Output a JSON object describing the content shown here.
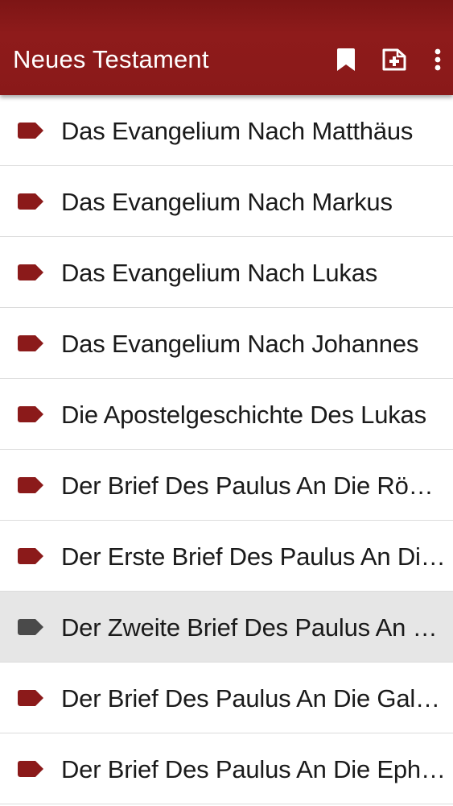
{
  "appbar": {
    "title": "Neues Testament",
    "actions": [
      {
        "icon": "bookmark-icon"
      },
      {
        "icon": "add-note-icon"
      },
      {
        "icon": "more-vert-icon"
      }
    ]
  },
  "colors": {
    "brand": "#8a1919",
    "tag": "#8b1a1a",
    "tag_selected": "#4a4a4a",
    "selected_row": "#e6e6e6"
  },
  "books": [
    {
      "title": "Das Evangelium Nach Matthäus",
      "selected": false
    },
    {
      "title": "Das Evangelium Nach Markus",
      "selected": false
    },
    {
      "title": "Das Evangelium Nach Lukas",
      "selected": false
    },
    {
      "title": "Das Evangelium Nach Johannes",
      "selected": false
    },
    {
      "title": "Die Apostelgeschichte Des Lukas",
      "selected": false
    },
    {
      "title": "Der Brief Des Paulus An Die Römer",
      "selected": false
    },
    {
      "title": "Der Erste Brief Des Paulus An Die Korinther",
      "selected": false
    },
    {
      "title": "Der Zweite Brief Des Paulus An Die Korinther",
      "selected": true
    },
    {
      "title": "Der Brief Des Paulus An Die Galater",
      "selected": false
    },
    {
      "title": "Der Brief Des Paulus An Die Epheser",
      "selected": false
    }
  ]
}
